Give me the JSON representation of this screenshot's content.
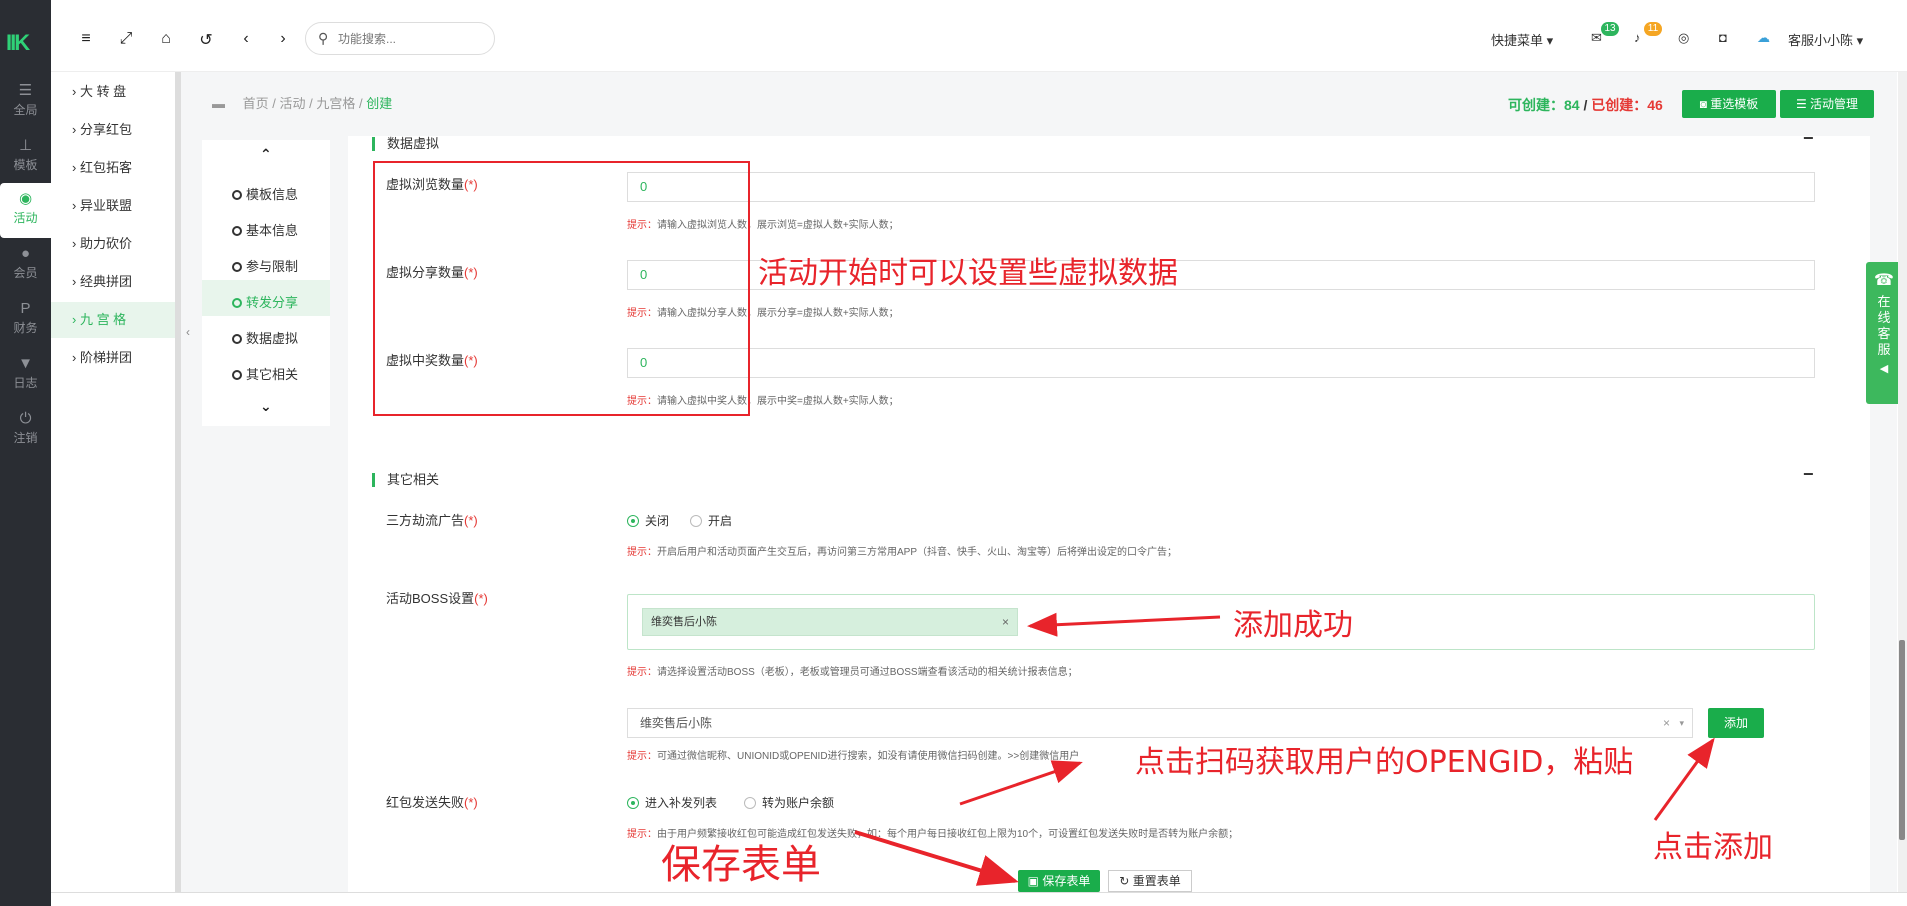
{
  "rail": {
    "logo": "IIK",
    "items": [
      {
        "label": "全局",
        "icon": "sliders-icon"
      },
      {
        "label": "模板",
        "icon": "sitemap-icon"
      },
      {
        "label": "活动",
        "icon": "podcast-icon"
      },
      {
        "label": "会员",
        "icon": "users-icon"
      },
      {
        "label": "财务",
        "icon": "paypal-icon"
      },
      {
        "label": "日志",
        "icon": "shield-icon"
      },
      {
        "label": "注销",
        "icon": "power-icon"
      }
    ]
  },
  "topbar": {
    "search_placeholder": "功能搜索...",
    "quick_menu": "快捷菜单",
    "mail_badge": "13",
    "bell_badge": "11",
    "user_name": "客服小小陈"
  },
  "subnav": {
    "items": [
      "大 转 盘",
      "分享红包",
      "红包拓客",
      "异业联盟",
      "助力砍价",
      "经典拼团",
      "九 宫 格",
      "阶梯拼团"
    ],
    "active_index": 6
  },
  "breadcrumb": {
    "path": [
      "首页",
      "活动",
      "九宫格"
    ],
    "current": "创建"
  },
  "counts": {
    "can_create_label": "可创建：",
    "can_create": "84",
    "created_label": "已创建：",
    "created": "46",
    "sep": " / "
  },
  "header_buttons": {
    "reselect": "重选模板",
    "manage": "活动管理"
  },
  "steps": {
    "items": [
      "模板信息",
      "基本信息",
      "参与限制",
      "转发分享",
      "数据虚拟",
      "其它相关"
    ],
    "active_index": 3
  },
  "virtual": {
    "title": "数据虚拟",
    "fields": [
      {
        "label": "虚拟浏览数量",
        "value": "0",
        "hint_key": "提示：",
        "hint": "请输入虚拟浏览人数，展示浏览=虚拟人数+实际人数；"
      },
      {
        "label": "虚拟分享数量",
        "value": "0",
        "hint_key": "提示：",
        "hint": "请输入虚拟分享人数，展示分享=虚拟人数+实际人数；"
      },
      {
        "label": "虚拟中奖数量",
        "value": "0",
        "hint_key": "提示：",
        "hint": "请输入虚拟中奖人数，展示中奖=虚拟人数+实际人数；"
      }
    ],
    "req": "(*)"
  },
  "other": {
    "title": "其它相关",
    "ad_label": "三方劫流广告",
    "ad_options": [
      "关闭",
      "开启"
    ],
    "ad_hint_key": "提示：",
    "ad_hint": "开启后用户和活动页面产生交互后，再访问第三方常用APP（抖音、快手、火山、淘宝等）后将弹出设定的口令广告；",
    "boss_label": "活动BOSS设置",
    "boss_tag": "维奕售后小陈",
    "boss_tag_close": "×",
    "boss_hint_key": "提示：",
    "boss_hint": "请选择设置活动BOSS（老板），老板或管理员可通过BOSS端查看该活动的相关统计报表信息；",
    "select_value": "维奕售后小陈",
    "select_clear": "×",
    "select_caret": "▾",
    "add_button": "添加",
    "search_hint_key": "提示：",
    "search_hint": "可通过微信昵称、UNIONID或OPENID进行搜索，如没有请使用微信扫码创建。>>创建微信用户",
    "redpack_label": "红包发送失败",
    "redpack_options": [
      "进入补发列表",
      "转为账户余额"
    ],
    "redpack_hint_key": "提示：",
    "redpack_hint": "由于用户频繁接收红包可能造成红包发送失败，如：每个用户每日接收红包上限为10个，可设置红包发送失败时是否转为账户余额；",
    "req": "(*)"
  },
  "form_buttons": {
    "save": "保存表单",
    "reset": "重置表单"
  },
  "annotations": {
    "virtual_note": "活动开始时可以设置些虚拟数据",
    "added_ok": "添加成功",
    "scan_note": "点击扫码获取用户的OPENGID，粘贴",
    "click_add": "点击添加",
    "save_note": "保存表单"
  },
  "service_tab": "在线客服",
  "colors": {
    "accent": "#2db55d",
    "annotation": "#e8242b",
    "rail_bg": "#2a2d33"
  }
}
